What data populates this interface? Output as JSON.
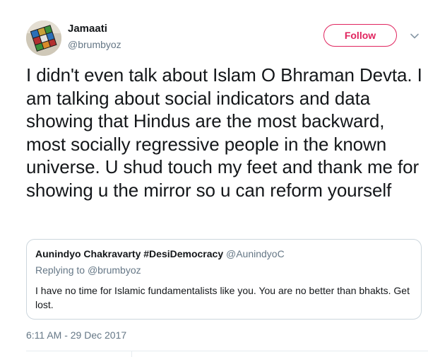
{
  "author": {
    "name": "Jamaati",
    "handle": "@brumbyoz"
  },
  "follow_button": {
    "label": "Follow",
    "color": "#e0245e"
  },
  "menu": {
    "icon": "chevron-down-icon"
  },
  "tweet": {
    "text": "I didn't even talk about Islam O Bhraman Devta. I am talking about social indicators and data showing that Hindus are the most backward, most socially regressive people in the known universe. U shud touch my feet and thank me for showing u the mirror so u can reform yourself",
    "timestamp": "6:11 AM - 29 Dec 2017"
  },
  "quoted_tweet": {
    "author_name": "Aunindyo Chakravarty #DesiDemocracy",
    "author_handle": "@AunindyoC",
    "replying_prefix": "Replying to",
    "replying_handle": "@brumbyoz",
    "text": "I have no time for Islamic fundamentalists like you. You are no better than bhakts. Get lost."
  },
  "colors": {
    "text_primary": "#14171a",
    "text_secondary": "#657786",
    "border": "#ccd6dd"
  }
}
